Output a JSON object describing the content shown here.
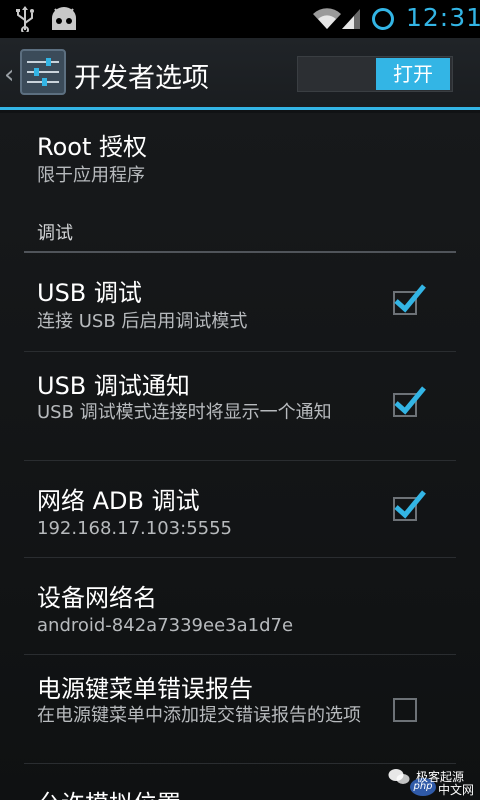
{
  "status_bar": {
    "time": "12:31"
  },
  "action_bar": {
    "title": "开发者选项",
    "switch_label": "打开"
  },
  "root": {
    "title": "Root 授权",
    "summary": "限于应用程序"
  },
  "category": {
    "label": "调试"
  },
  "prefs": [
    {
      "title": "USB 调试",
      "summary": "连接 USB 后启用调试模式",
      "checked": true
    },
    {
      "title": "USB 调试通知",
      "summary": "USB 调试模式连接时将显示一个通知",
      "checked": true
    },
    {
      "title": "网络 ADB 调试",
      "summary": "192.168.17.103:5555",
      "checked": true
    },
    {
      "title": "设备网络名",
      "summary": "android-842a7339ee3a1d7e"
    },
    {
      "title": "电源键菜单错误报告",
      "summary": "在电源键菜单中添加提交错误报告的选项",
      "checked": false
    },
    {
      "title": "允许模拟位置"
    }
  ],
  "colors": {
    "accent": "#33b5e5",
    "background": "#101214"
  },
  "watermark": {
    "line1": "极客起源",
    "line2": "中文网",
    "badge": "php"
  }
}
